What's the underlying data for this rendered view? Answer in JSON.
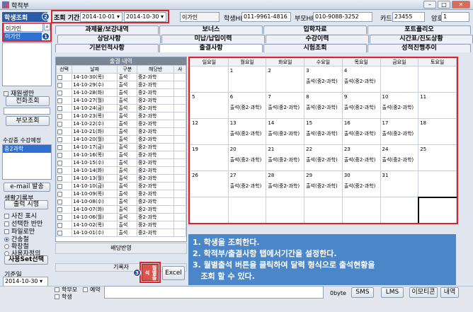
{
  "window": {
    "title": "학적부",
    "min": "–",
    "max": "□",
    "close": "✕"
  },
  "search": {
    "student_lookup_label": "학생조회",
    "period_label": "조회 기간",
    "date_from": "2014-10-01",
    "date_to": "2014-10-30",
    "name_value": "이가인",
    "student_hp_label": "학생HP",
    "student_hp": "011-9961-4816",
    "parent_hp_label": "부모HP",
    "parent_hp": "010-9088-3252",
    "card_label": "카드번호",
    "card_value": "23455",
    "pw_label": "암호",
    "pw_value": "1"
  },
  "left": {
    "name_input": "이가인",
    "list_selected": "이가인",
    "reenroll_label": "재원생만",
    "phone_lookup": "전화조회",
    "parent_lookup": "부모조회",
    "course_label": "수강중 수강예정",
    "course_selected": "중2과학",
    "email_btn": "e-mail 발송",
    "life_record_label": "생활기록부",
    "print_btn": "출력 시행",
    "opts": [
      "사진 표시",
      "선택한 반만",
      "파일로만"
    ],
    "radios": [
      "간송철",
      "확장철",
      "사용자정의"
    ],
    "user_set_btn": "사용Set선택",
    "base_date_label": "기준일",
    "base_date": "2014-10-30"
  },
  "tabs_row1": [
    "과제물/보강내역",
    "보너스",
    "입학자료",
    "포트폴리오"
  ],
  "tabs_row2": [
    "상담사항",
    "미납/납입이력",
    "수강이력",
    "시간표/진도상황"
  ],
  "tabs_row3": [
    "기본인적사항",
    "출결사항",
    "시험조회",
    "성적진행추이"
  ],
  "attendance": {
    "header": "출결 내역",
    "columns": [
      "선택",
      "날짜",
      "구분",
      "해당반",
      "사"
    ],
    "rows": [
      [
        "14-10-30(목)",
        "출석",
        "중2-과학"
      ],
      [
        "14-10-29(수)",
        "출석",
        "중2-과학"
      ],
      [
        "14-10-28(화)",
        "출석",
        "중2-과학"
      ],
      [
        "14-10-27(월)",
        "출석",
        "중2-과학"
      ],
      [
        "14-10-24(금)",
        "출석",
        "중2-과학"
      ],
      [
        "14-10-23(목)",
        "출석",
        "중2-과학"
      ],
      [
        "14-10-22(수)",
        "출석",
        "중2-과학"
      ],
      [
        "14-10-21(화)",
        "출석",
        "중2-과학"
      ],
      [
        "14-10-20(월)",
        "출석",
        "중2-과학"
      ],
      [
        "14-10-17(금)",
        "출석",
        "중2-과학"
      ],
      [
        "14-10-16(목)",
        "출석",
        "중2-과학"
      ],
      [
        "14-10-15(수)",
        "출석",
        "중2-과학"
      ],
      [
        "14-10-14(화)",
        "출석",
        "중2-과학"
      ],
      [
        "14-10-13(월)",
        "출석",
        "중2-과학"
      ],
      [
        "14-10-10(금)",
        "출석",
        "중2-과학"
      ],
      [
        "14-10-09(목)",
        "출석",
        "중2-과학"
      ],
      [
        "14-10-08(수)",
        "출석",
        "중2-과학"
      ],
      [
        "14-10-07(화)",
        "출석",
        "중2-과학"
      ],
      [
        "14-10-06(월)",
        "출석",
        "중2-과학"
      ],
      [
        "14-10-02(목)",
        "출석",
        "중2-과학"
      ],
      [
        "14-10-01(수)",
        "출석",
        "중2-과학"
      ]
    ],
    "sub_label1": "배당반영",
    "sub_label2": "기록자",
    "monthly_btn": "월별출석",
    "excel_btn": "Excel"
  },
  "calendar": {
    "days": [
      "일요일",
      "월요일",
      "화요일",
      "수요일",
      "목요일",
      "금요일",
      "토요일"
    ],
    "weeks": [
      [
        [
          "",
          ""
        ],
        [
          "1",
          ""
        ],
        [
          "2",
          ""
        ],
        [
          "3",
          "출석(중2-과학)"
        ],
        [
          "4",
          "출석(중2-과학)"
        ],
        [
          "",
          ""
        ],
        [
          "",
          ""
        ]
      ],
      [
        [
          "5",
          ""
        ],
        [
          "6",
          "출석(중2-과학)"
        ],
        [
          "7",
          "출석(중2-과학)"
        ],
        [
          "8",
          "출석(중2-과학)"
        ],
        [
          "9",
          "출석(중2-과학)"
        ],
        [
          "10",
          "출석(중2-과학)"
        ],
        [
          "11",
          ""
        ]
      ],
      [
        [
          "12",
          ""
        ],
        [
          "13",
          "출석(중2-과학)"
        ],
        [
          "14",
          "출석(중2-과학)"
        ],
        [
          "15",
          "출석(중2-과학)"
        ],
        [
          "16",
          "출석(중2-과학)"
        ],
        [
          "17",
          "출석(중2-과학)"
        ],
        [
          "18",
          ""
        ]
      ],
      [
        [
          "19",
          ""
        ],
        [
          "20",
          "출석(중2-과학)"
        ],
        [
          "21",
          "출석(중2-과학)"
        ],
        [
          "22",
          "출석(중2-과학)"
        ],
        [
          "23",
          "출석(중2-과학)"
        ],
        [
          "24",
          "출석(중2-과학)"
        ],
        [
          "25",
          ""
        ]
      ],
      [
        [
          "26",
          ""
        ],
        [
          "27",
          "출석(중2-과학)"
        ],
        [
          "28",
          "출석(중2-과학)"
        ],
        [
          "29",
          "출석(중2-과학)"
        ],
        [
          "30",
          "출석(중2-과학)"
        ],
        [
          "31",
          ""
        ],
        [
          "",
          ""
        ]
      ],
      [
        [
          "",
          ""
        ],
        [
          "",
          ""
        ],
        [
          "",
          ""
        ],
        [
          "",
          ""
        ],
        [
          "",
          ""
        ],
        [
          "",
          ""
        ],
        [
          "",
          ""
        ]
      ]
    ]
  },
  "note_lines": [
    "1. 학생을 조회한다.",
    "2. 학적부/출결사항 탭에서기간을 설정한다.",
    "3. 월별출석 버튼을 클릭하여 달력 형식으로 출석현황을",
    "   조회 할 수 있다."
  ],
  "bottom": {
    "chk_parent": "학부모",
    "chk_student": "학생",
    "chk_reserve": "예약",
    "bytes": "0byte",
    "sms": "SMS",
    "lms": "LMS",
    "emoticon": "이모티콘",
    "history": "내역"
  },
  "badges": [
    "1",
    "2",
    "3"
  ]
}
